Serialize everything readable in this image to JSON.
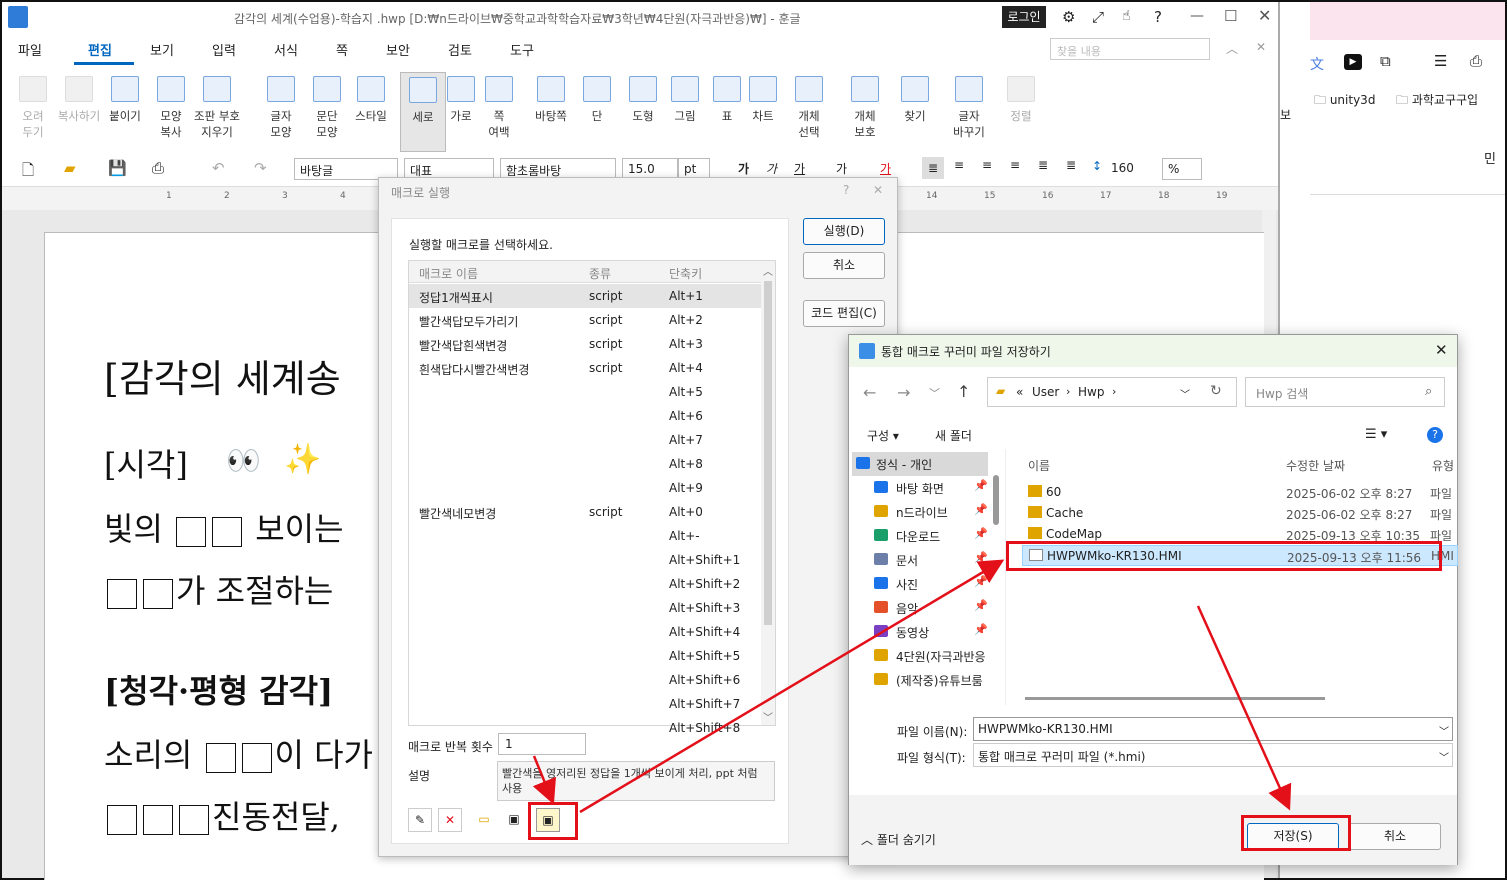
{
  "window": {
    "title": "감각의 세계(수업용)-학습지 .hwp [D:₩n드라이브₩중학교과학학습자료₩3학년₩4단원(자극과반응)₩] - 훈글",
    "login": "로그인",
    "help": "?"
  },
  "menu": {
    "items": [
      "파일",
      "편집",
      "보기",
      "입력",
      "서식",
      "쪽",
      "보안",
      "검토",
      "도구"
    ],
    "active": "편집",
    "search_placeholder": "찾을 내용"
  },
  "ribbon": {
    "groups": [
      {
        "label": "오려\n두기",
        "icon": "scissors-icon",
        "disabled": true
      },
      {
        "label": "복사하기",
        "icon": "copy-icon",
        "disabled": true
      },
      {
        "label": "붙이기",
        "icon": "paste-icon",
        "disabled": false
      },
      {
        "label": "모양\n복사",
        "icon": "format-painter-icon",
        "disabled": false
      },
      {
        "label": "조판 부호\n지우기",
        "icon": "clear-code-icon",
        "disabled": false
      },
      {
        "label": "글자\n모양",
        "icon": "char-shape-icon",
        "disabled": false
      },
      {
        "label": "문단\n모양",
        "icon": "para-shape-icon",
        "disabled": false
      },
      {
        "label": "스타일",
        "icon": "style-icon",
        "disabled": false
      },
      {
        "label": "세로",
        "icon": "portrait-icon",
        "disabled": false
      },
      {
        "label": "가로",
        "icon": "landscape-icon",
        "disabled": false
      },
      {
        "label": "쪽\n여백",
        "icon": "margin-icon",
        "disabled": false
      },
      {
        "label": "바탕쪽",
        "icon": "master-page-icon",
        "disabled": false
      },
      {
        "label": "단",
        "icon": "column-icon",
        "disabled": false
      },
      {
        "label": "도형",
        "icon": "shape-icon",
        "disabled": false
      },
      {
        "label": "그림",
        "icon": "picture-icon",
        "disabled": false
      },
      {
        "label": "표",
        "icon": "table-icon",
        "disabled": false
      },
      {
        "label": "차트",
        "icon": "chart-icon",
        "disabled": false
      },
      {
        "label": "개체\n선택",
        "icon": "select-object-icon",
        "disabled": false
      },
      {
        "label": "개체\n보호",
        "icon": "protect-object-icon",
        "disabled": false
      },
      {
        "label": "찾기",
        "icon": "binoculars-icon",
        "disabled": false
      },
      {
        "label": "글자\n바꾸기",
        "icon": "replace-icon",
        "disabled": false
      },
      {
        "label": "정렬",
        "icon": "sort-icon",
        "disabled": true
      }
    ]
  },
  "format": {
    "style": "바탕글",
    "lang": "대표",
    "font": "함초롬바탕",
    "size": "15.0",
    "unit": "pt",
    "line_spacing": "160",
    "percent": "%"
  },
  "ruler": {
    "numbers": [
      "1",
      "2",
      "3",
      "4",
      "14",
      "15",
      "16",
      "17",
      "18",
      "19"
    ]
  },
  "document": {
    "title": "[감각의 세계송",
    "sec1": "[시각]",
    "line1a": "빛의",
    "line1b": "보이는",
    "line2": "가 조절하는",
    "sec2": "[청각·평형 감각]",
    "line3a": "소리의",
    "line3b": "이 다가",
    "line4": "진동전달,"
  },
  "browser": {
    "bookmark1": "unity3d",
    "bookmark2": "과학교구구입",
    "side_text": "민",
    "left_text": "보"
  },
  "macro_dialog": {
    "title": "매크로 실행",
    "prompt": "실행할 매크로를 선택하세요.",
    "columns": [
      "매크로 이름",
      "종류",
      "단축키"
    ],
    "rows": [
      {
        "name": "정답1개씩표시",
        "type": "script",
        "key": "Alt+1"
      },
      {
        "name": "빨간색답모두가리기",
        "type": "script",
        "key": "Alt+2"
      },
      {
        "name": "빨간색답흰색변경",
        "type": "script",
        "key": "Alt+3"
      },
      {
        "name": "흰색답다시빨간색변경",
        "type": "script",
        "key": "Alt+4"
      },
      {
        "name": "",
        "type": "",
        "key": "Alt+5"
      },
      {
        "name": "",
        "type": "",
        "key": "Alt+6"
      },
      {
        "name": "",
        "type": "",
        "key": "Alt+7"
      },
      {
        "name": "",
        "type": "",
        "key": "Alt+8"
      },
      {
        "name": "",
        "type": "",
        "key": "Alt+9"
      },
      {
        "name": "빨간색네모변경",
        "type": "script",
        "key": "Alt+0"
      },
      {
        "name": "",
        "type": "",
        "key": "Alt+-"
      },
      {
        "name": "",
        "type": "",
        "key": "Alt+Shift+1"
      },
      {
        "name": "",
        "type": "",
        "key": "Alt+Shift+2"
      },
      {
        "name": "",
        "type": "",
        "key": "Alt+Shift+3"
      },
      {
        "name": "",
        "type": "",
        "key": "Alt+Shift+4"
      },
      {
        "name": "",
        "type": "",
        "key": "Alt+Shift+5"
      },
      {
        "name": "",
        "type": "",
        "key": "Alt+Shift+6"
      },
      {
        "name": "",
        "type": "",
        "key": "Alt+Shift+7"
      },
      {
        "name": "",
        "type": "",
        "key": "Alt+Shift+8"
      }
    ],
    "run_button": "실행(D)",
    "cancel_button": "취소",
    "edit_button": "코드 편집(C)",
    "repeat_label": "매크로 반복 횟수",
    "repeat_value": "1",
    "desc_label": "설명",
    "desc_text": "빨간색을 영저리된 정답을 1개씩 보이게 처리, ppt 처럼 사용"
  },
  "save_dialog": {
    "title": "통합 매크로 꾸러미 파일 저장하기",
    "path": [
      "User",
      "Hwp"
    ],
    "search_placeholder": "Hwp 검색",
    "organize": "구성",
    "new_folder": "새 폴더",
    "nav_items": [
      {
        "label": "정식 - 개인",
        "icon": "cloud-icon",
        "pinned": false
      },
      {
        "label": "바탕 화면",
        "icon": "desktop-icon",
        "pinned": true
      },
      {
        "label": "n드라이브",
        "icon": "folder-icon",
        "pinned": true
      },
      {
        "label": "다운로드",
        "icon": "download-icon",
        "pinned": true
      },
      {
        "label": "문서",
        "icon": "documents-icon",
        "pinned": true
      },
      {
        "label": "사진",
        "icon": "pictures-icon",
        "pinned": true
      },
      {
        "label": "음악",
        "icon": "music-icon",
        "pinned": true
      },
      {
        "label": "동영상",
        "icon": "video-icon",
        "pinned": true
      },
      {
        "label": "4단원(자극과반응",
        "icon": "folder-icon",
        "pinned": false
      },
      {
        "label": "(제작중)유튜브룸",
        "icon": "folder-icon",
        "pinned": false
      }
    ],
    "columns": [
      "이름",
      "수정한 날짜",
      "유형"
    ],
    "files": [
      {
        "name": "60",
        "date": "2025-06-02 오후 8:27",
        "type": "파일",
        "kind": "folder"
      },
      {
        "name": "Cache",
        "date": "2025-06-02 오후 8:27",
        "type": "파일",
        "kind": "folder"
      },
      {
        "name": "CodeMap",
        "date": "2025-09-13 오후 10:35",
        "type": "파일",
        "kind": "folder"
      },
      {
        "name": "HWPWMko-KR130.HMI",
        "date": "2025-09-13 오후 11:56",
        "type": "HMI",
        "kind": "file"
      }
    ],
    "filename_label": "파일 이름(N):",
    "filename_value": "HWPWMko-KR130.HMI",
    "filetype_label": "파일 형식(T):",
    "filetype_value": "통합 매크로 꾸러미 파일 (*.hmi)",
    "hide_folders": "폴더 숨기기",
    "save_button": "저장(S)",
    "cancel_button": "취소"
  },
  "colors": {
    "accent": "#0067c0",
    "highlight": "#e3101a",
    "selection": "#cce8ff"
  }
}
